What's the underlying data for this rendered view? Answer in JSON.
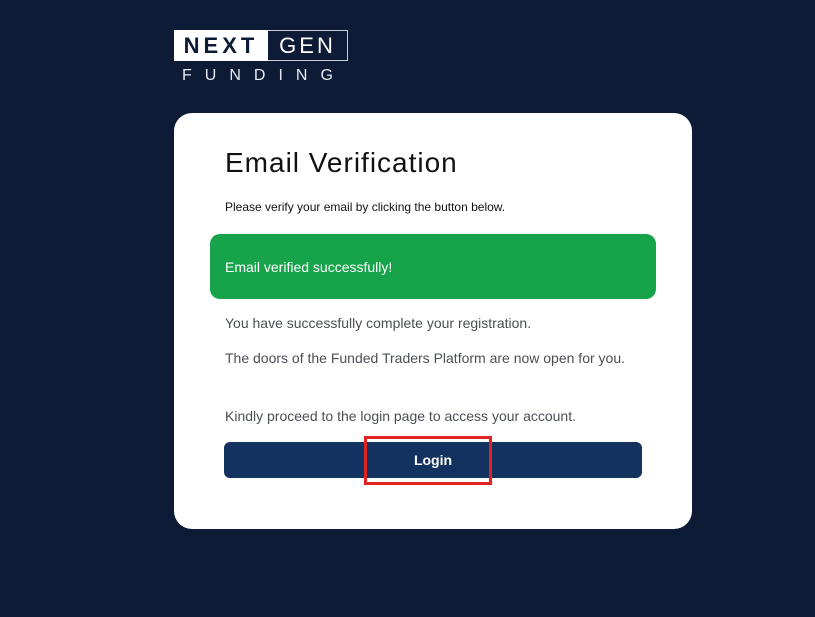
{
  "logo": {
    "top_left": "NEXT",
    "top_right": "GEN",
    "bottom": "FUNDING"
  },
  "card": {
    "title": "Email Verification",
    "subtitle": "Please verify your email by clicking the button below.",
    "alert_text": "Email verified successfully!",
    "messages": [
      "You have successfully complete your registration.",
      "The doors of the Funded Traders Platform are now open for you.",
      "Kindly proceed to the login page to access your account."
    ],
    "login_label": "Login"
  },
  "colors": {
    "background": "#0d1b36",
    "alert": "#16a34a",
    "button": "#14325f",
    "highlight": "#e02424"
  }
}
